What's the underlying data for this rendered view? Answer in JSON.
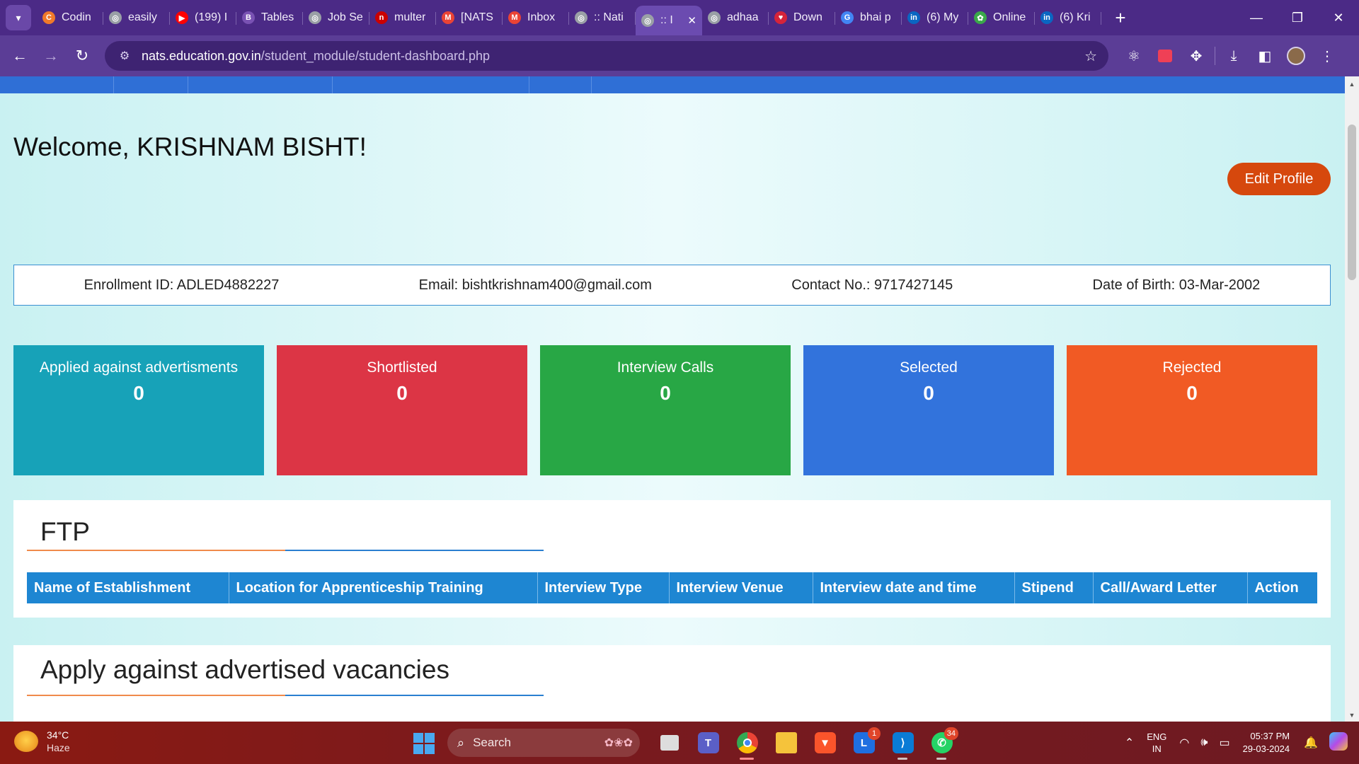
{
  "browser": {
    "tabs": [
      {
        "title": "Codin",
        "icon": "coding-ninjas-icon",
        "color": "#f07a2a",
        "glyph": "C"
      },
      {
        "title": "easily",
        "icon": "globe-icon",
        "color": "#9aa0a6",
        "glyph": "◎"
      },
      {
        "title": "(199) I",
        "icon": "youtube-icon",
        "color": "#ff0000",
        "glyph": "▶"
      },
      {
        "title": "Tables",
        "icon": "bootstrap-icon",
        "color": "#7952b3",
        "glyph": "B"
      },
      {
        "title": "Job Se",
        "icon": "globe-icon",
        "color": "#9aa0a6",
        "glyph": "◎"
      },
      {
        "title": "multer",
        "icon": "npm-icon",
        "color": "#cb0000",
        "glyph": "n"
      },
      {
        "title": "[NATS",
        "icon": "gmail-icon",
        "color": "#ea4335",
        "glyph": "M"
      },
      {
        "title": "Inbox",
        "icon": "gmail-icon",
        "color": "#ea4335",
        "glyph": "M"
      },
      {
        "title": ":: Nati",
        "icon": "globe-icon",
        "color": "#9aa0a6",
        "glyph": "◎"
      },
      {
        "title": ":: I",
        "icon": "globe-icon",
        "color": "#9aa0a6",
        "glyph": "◎",
        "active": true
      },
      {
        "title": "adhaa",
        "icon": "globe-icon",
        "color": "#9aa0a6",
        "glyph": "◎"
      },
      {
        "title": "Down",
        "icon": "heart-icon",
        "color": "#d6243a",
        "glyph": "♥"
      },
      {
        "title": "bhai p",
        "icon": "google-icon",
        "color": "#4285f4",
        "glyph": "G"
      },
      {
        "title": "(6) My",
        "icon": "linkedin-icon",
        "color": "#0a66c2",
        "glyph": "in"
      },
      {
        "title": "Online",
        "icon": "gear-icon",
        "color": "#3aa84a",
        "glyph": "✿"
      },
      {
        "title": "(6) Kri",
        "icon": "linkedin-icon",
        "color": "#0a66c2",
        "glyph": "in"
      }
    ],
    "url_host": "nats.education.gov.in",
    "url_path": "/student_module/student-dashboard.php"
  },
  "page": {
    "welcome": "Welcome, KRISHNAM BISHT!",
    "edit_profile_label": "Edit Profile",
    "info": {
      "enrollment": "Enrollment ID: ADLED4882227",
      "email": "Email: bishtkrishnam400@gmail.com",
      "contact": "Contact No.: 9717427145",
      "dob": "Date of Birth: 03-Mar-2002"
    },
    "cards": [
      {
        "label": "Applied against advertisments",
        "count": "0",
        "color": "#17a2b8"
      },
      {
        "label": "Shortlisted",
        "count": "0",
        "color": "#dc3545"
      },
      {
        "label": "Interview Calls",
        "count": "0",
        "color": "#28a745"
      },
      {
        "label": "Selected",
        "count": "0",
        "color": "#3273dc"
      },
      {
        "label": "Rejected",
        "count": "0",
        "color": "#f15a24"
      }
    ],
    "ftp": {
      "title": "FTP",
      "columns": [
        "Name of Establishment",
        "Location for Apprenticeship Training",
        "Interview Type",
        "Interview Venue",
        "Interview date and time",
        "Stipend",
        "Call/Award Letter",
        "Action"
      ]
    },
    "apply_title": "Apply against advertised vacancies"
  },
  "taskbar": {
    "weather_temp": "34°C",
    "weather_desc": "Haze",
    "search_label": "Search",
    "whatsapp_badge": "34",
    "lens_badge": "1",
    "lang_line1": "ENG",
    "lang_line2": "IN",
    "time": "05:37 PM",
    "date": "29-03-2024"
  }
}
